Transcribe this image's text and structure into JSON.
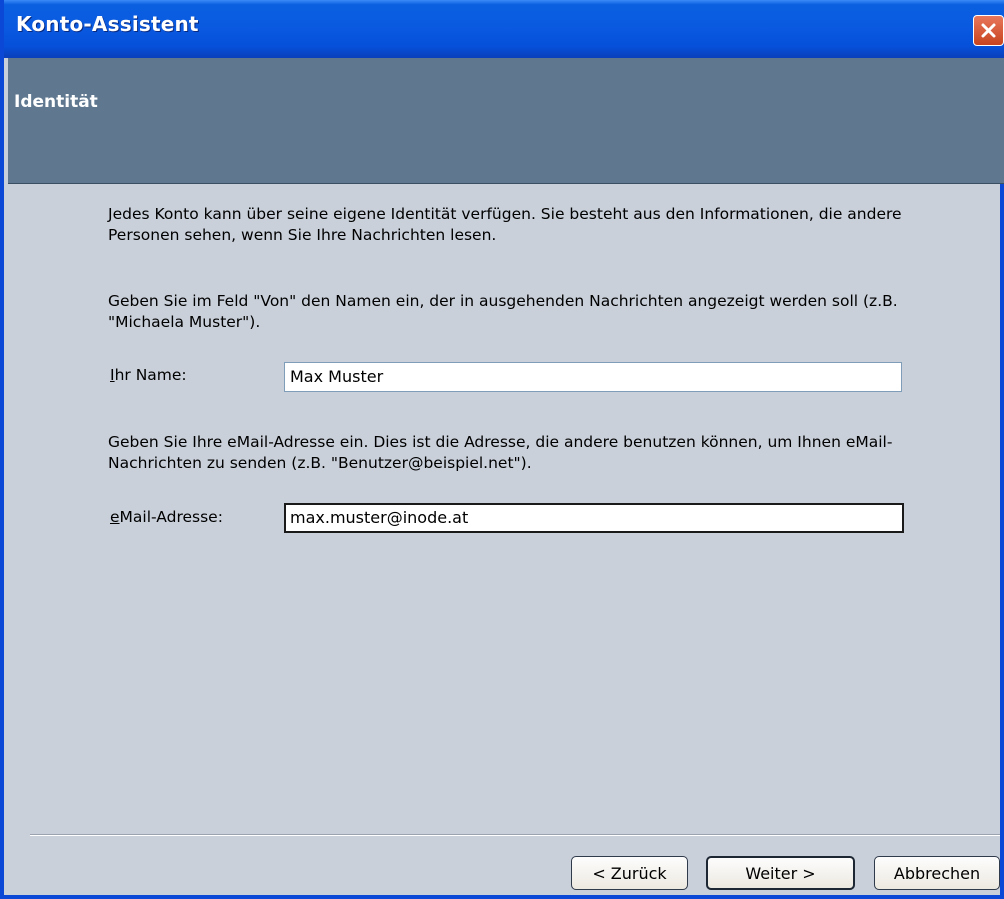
{
  "window": {
    "title": "Konto-Assistent"
  },
  "header": {
    "title": "Identität"
  },
  "content": {
    "intro_text": "Jedes Konto kann über seine eigene Identität verfügen. Sie besteht aus den Informationen, die andere Personen sehen, wenn Sie Ihre Nachrichten lesen.",
    "name_help": "Geben Sie im Feld \"Von\" den Namen ein, der in ausgehenden Nachrichten angezeigt werden soll (z.B. \"Michaela Muster\").",
    "name_label_key": "I",
    "name_label_rest": "hr Name:",
    "name_value": "Max Muster",
    "email_help": "Geben Sie Ihre eMail-Adresse ein. Dies ist die Adresse, die andere benutzen können, um Ihnen eMail-Nachrichten zu senden (z.B. \"Benutzer@beispiel.net\").",
    "email_label_key": "e",
    "email_label_rest": "Mail-Adresse:",
    "email_value": "max.muster@inode.at"
  },
  "buttons": {
    "back": "< Zurück",
    "next": "Weiter >",
    "cancel": "Abbrechen"
  },
  "icons": {
    "close": "close-icon"
  },
  "colors": {
    "titlebar": "#0a5ae0",
    "header_band": "#5f7890",
    "body_bg": "#c9d0da",
    "close_button": "#d8593a"
  }
}
